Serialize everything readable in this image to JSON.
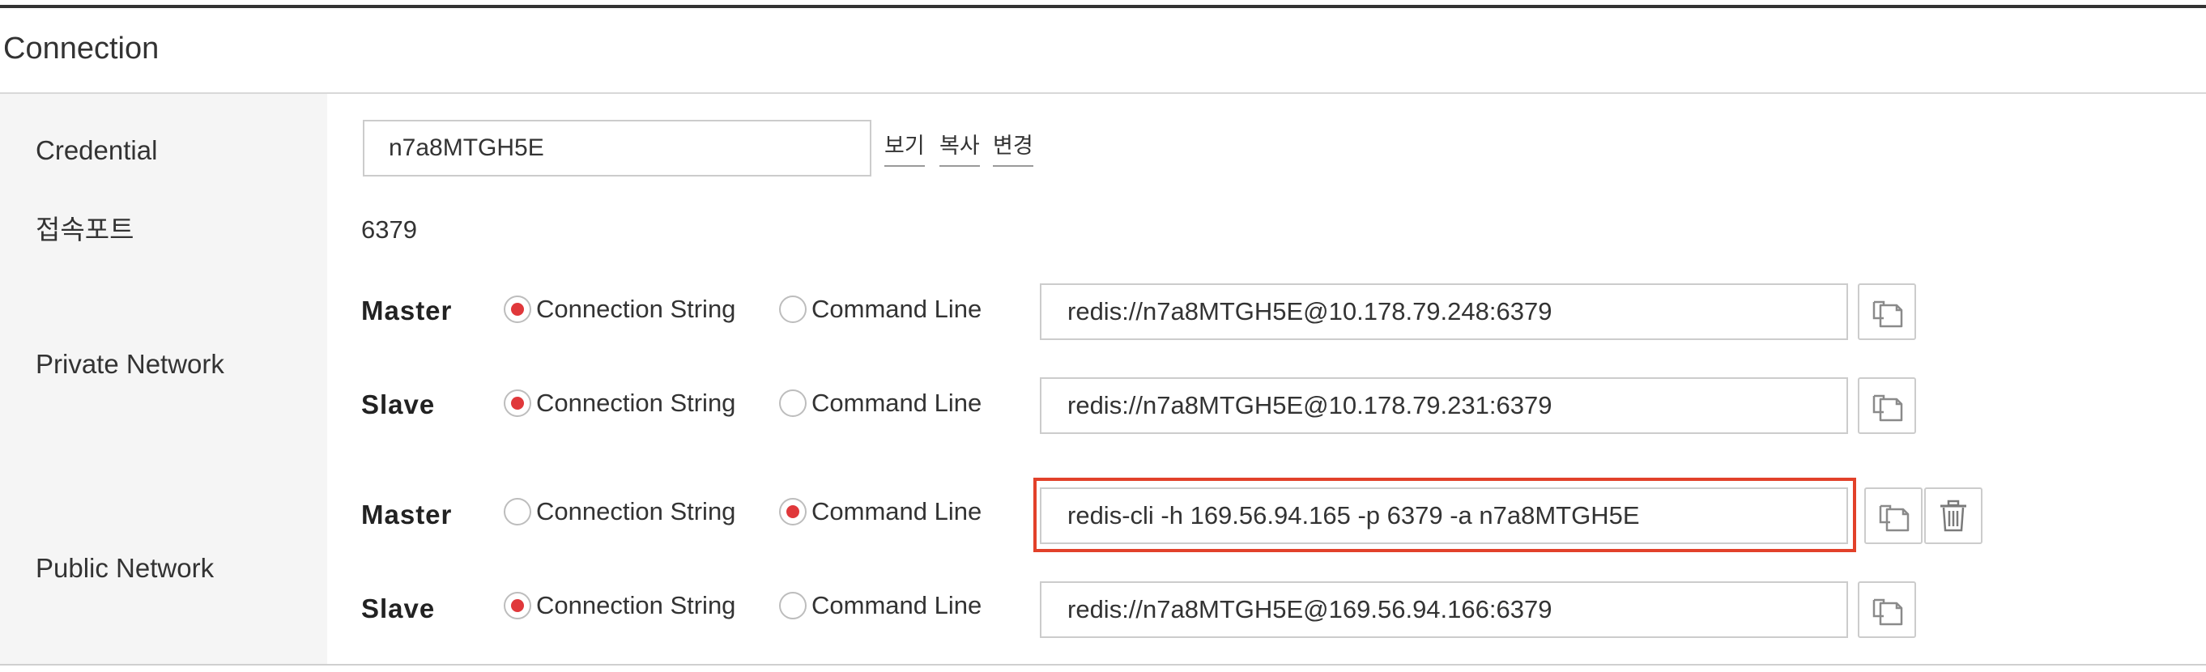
{
  "section": {
    "title": "Connection"
  },
  "credential": {
    "label": "Credential",
    "value": "n7a8MTGH5E",
    "links": {
      "view": "보기",
      "copy": "복사",
      "change": "변경"
    }
  },
  "port": {
    "label": "접속포트",
    "value": "6379"
  },
  "private_network": {
    "label": "Private Network",
    "rows": [
      {
        "name": "Master",
        "option_connection_string": "Connection String",
        "option_command_line": "Command Line",
        "selected": "connection_string",
        "value": "redis://n7a8MTGH5E@10.178.79.248:6379"
      },
      {
        "name": "Slave",
        "option_connection_string": "Connection String",
        "option_command_line": "Command Line",
        "selected": "connection_string",
        "value": "redis://n7a8MTGH5E@10.178.79.231:6379"
      }
    ]
  },
  "public_network": {
    "label": "Public Network",
    "rows": [
      {
        "name": "Master",
        "option_connection_string": "Connection String",
        "option_command_line": "Command Line",
        "selected": "command_line",
        "value": "redis-cli -h 169.56.94.165 -p 6379 -a n7a8MTGH5E"
      },
      {
        "name": "Slave",
        "option_connection_string": "Connection String",
        "option_command_line": "Command Line",
        "selected": "connection_string",
        "value": "redis://n7a8MTGH5E@169.56.94.166:6379"
      }
    ]
  },
  "icons": {
    "copy": "copy-icon",
    "delete": "trash-icon"
  },
  "colors": {
    "accent": "#e0383b",
    "highlight_border": "#e2412a"
  }
}
